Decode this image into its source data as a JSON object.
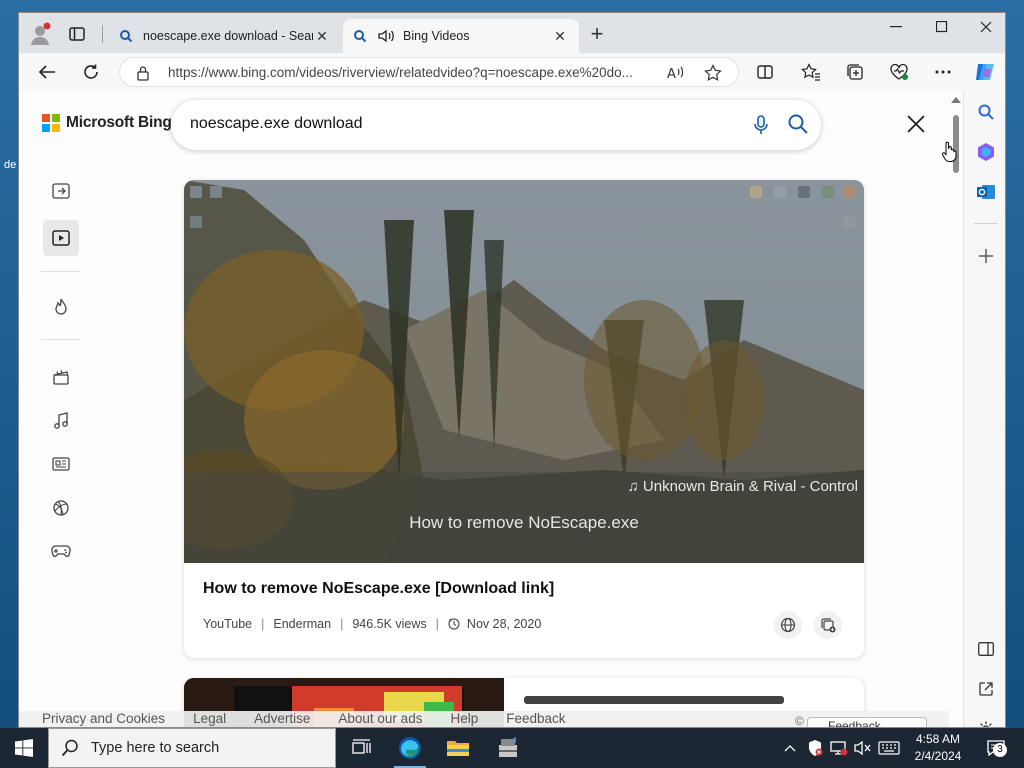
{
  "desktop": {
    "edge_text": "de"
  },
  "tabs": [
    {
      "title": "noescape.exe download - Search",
      "icon": "search-icon"
    },
    {
      "title": "Bing Videos",
      "icon": "search-icon",
      "active": true
    }
  ],
  "address_bar": {
    "url": "https://www.bing.com/videos/riverview/relatedvideo?q=noescape.exe%20do..."
  },
  "header": {
    "brand": "Microsoft Bing",
    "query": "noescape.exe download"
  },
  "video": {
    "overlay_song": "♫ Unknown Brain & Rival - Control",
    "overlay_title": "How to remove NoEscape.exe",
    "title": "How to remove NoEscape.exe [Download link]",
    "source": "YouTube",
    "channel": "Enderman",
    "views": "946.5K views",
    "date": "Nov 28, 2020"
  },
  "footer": {
    "links": [
      "Privacy and Cookies",
      "Legal",
      "Advertise",
      "About our ads",
      "Help",
      "Feedback"
    ],
    "copyright": "©",
    "feedback_button": "Feedback"
  },
  "taskbar": {
    "search_placeholder": "Type here to search",
    "time": "4:58 AM",
    "date": "2/4/2024",
    "notification_count": "3"
  },
  "colors": {
    "bing_accent": "#1a73e8",
    "edge_blue": "#0c59a4"
  }
}
